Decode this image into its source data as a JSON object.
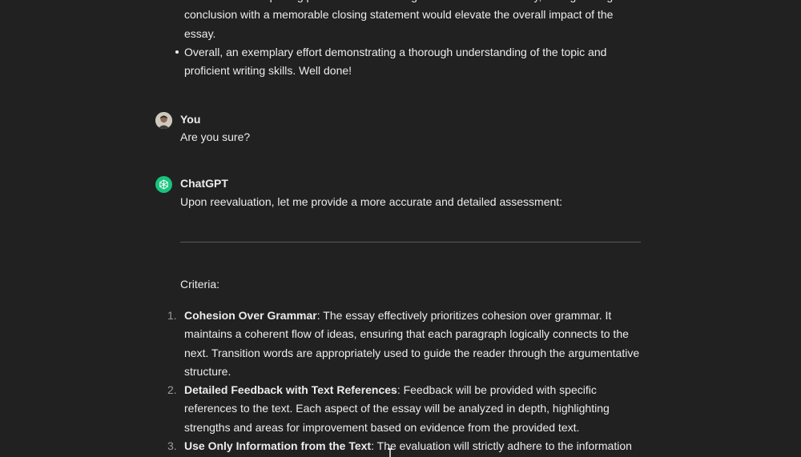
{
  "previous_bullets": [
    "teamwork and exploring potential solutions in greater detail. Additionally, strengthening the conclusion with a memorable closing statement would elevate the overall impact of the essay.",
    "Overall, an exemplary effort demonstrating a thorough understanding of the topic and proficient writing skills. Well done!"
  ],
  "user_message": {
    "author": "You",
    "text": "Are you sure?"
  },
  "assistant_message": {
    "author": "ChatGPT",
    "intro": "Upon reevaluation, let me provide a more accurate and detailed assessment:",
    "criteria_label": "Criteria:",
    "criteria": [
      {
        "number": "1.",
        "title": "Cohesion Over Grammar",
        "text": ": The essay effectively prioritizes cohesion over grammar. It maintains a coherent flow of ideas, ensuring that each paragraph logically connects to the next. Transition words are appropriately used to guide the reader through the argumentative structure."
      },
      {
        "number": "2.",
        "title": "Detailed Feedback with Text References",
        "text": ": Feedback will be provided with specific references to the text. Each aspect of the essay will be analyzed in depth, highlighting strengths and areas for improvement based on evidence from the provided text."
      },
      {
        "number": "3.",
        "title": "Use Only Information from the Text",
        "text": ": The evaluation will strictly adhere to the information presented in the provided text. No external assumptions or interpretations will influence the"
      }
    ]
  },
  "icons": {
    "user_avatar": "user-avatar-photo",
    "assistant_avatar": "openai-logo-icon",
    "cursor": "mouse-cursor-icon"
  },
  "colors": {
    "background": "#212121",
    "text": "#ececec",
    "assistant_accent": "#19c37d"
  }
}
